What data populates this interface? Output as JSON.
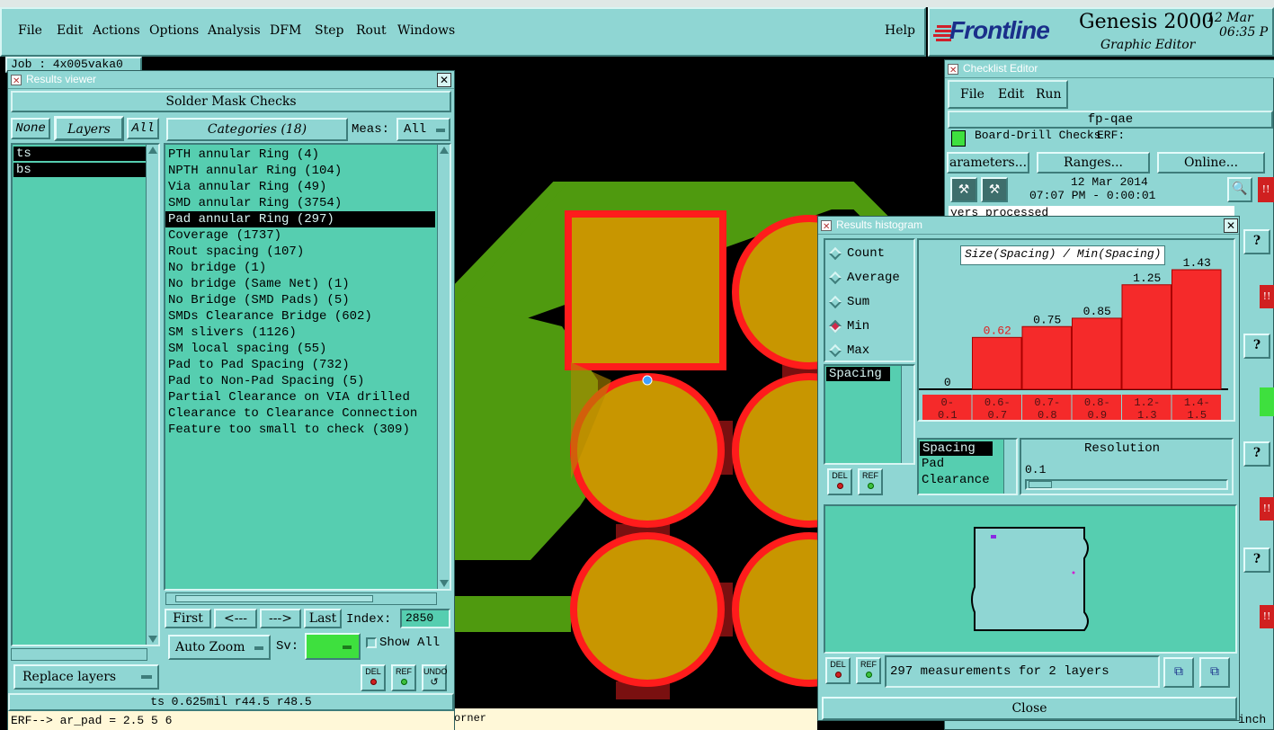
{
  "app_title": "Graphic Editor  Genesis 2000 - [fp-qae]",
  "menu": [
    "File",
    "Edit",
    "Actions",
    "Options",
    "Analysis",
    "DFM",
    "Step",
    "Rout",
    "Windows"
  ],
  "help": "Help",
  "brand": {
    "logo": "Frontline",
    "product": "Genesis 2000",
    "subtitle": "Graphic Editor",
    "date": "12 Mar",
    "time": "06:35 P"
  },
  "job_label": "Job : 4x005vaka0",
  "results_viewer": {
    "title": "Results viewer",
    "header": "Solder Mask Checks",
    "none": "None",
    "layers": "Layers",
    "all": "All",
    "layer_list": [
      "ts",
      "bs"
    ],
    "categories": "Categories (18)",
    "meas_label": "Meas:",
    "meas_value": "All",
    "category_list": [
      "PTH annular Ring (4)",
      "NPTH annular Ring (104)",
      "Via annular Ring (49)",
      "SMD annular Ring (3754)",
      "Pad annular Ring (297)",
      "Coverage (1737)",
      "Rout spacing (107)",
      "No bridge (1)",
      "No bridge (Same Net) (1)",
      "No Bridge (SMD Pads) (5)",
      "SMDs Clearance Bridge (602)",
      "SM slivers (1126)",
      "SM local spacing (55)",
      "Pad to Pad Spacing (732)",
      "Pad to Non-Pad Spacing (5)",
      "Partial Clearance on VIA drilled",
      "Clearance to Clearance Connection",
      "Feature too small to check (309)"
    ],
    "selected_category": 4,
    "first": "First",
    "prev": "<---",
    "next": "--->",
    "last": "Last",
    "index_label": "Index:",
    "index_value": "2850",
    "auto_zoom": "Auto Zoom",
    "sv": "Sv:",
    "show_all": "Show All",
    "replace_layers": "Replace layers",
    "del": "DEL",
    "ref": "REF",
    "undo": "UNDO",
    "status": "ts 0.625mil  r44.5  r48.5",
    "erf": "ERF--> ar_pad = 2.5 5 6"
  },
  "bottom_status": "orner",
  "checklist": {
    "title": "Checklist Editor",
    "menu": [
      "File",
      "Edit",
      "Run"
    ],
    "step": "fp-qae",
    "row_label": "Board-Drill Checks",
    "erf": "ERF:",
    "parameters": "arameters...",
    "ranges": "Ranges...",
    "online": "Online...",
    "date": "12 Mar 2014",
    "time": "07:07 PM - 0:00:01",
    "processed": "yers processed",
    "unit": "inch"
  },
  "histogram": {
    "title": "Results histogram",
    "modes": [
      "Count",
      "Average",
      "Sum",
      "Min",
      "Max"
    ],
    "selected_mode": "Min",
    "chart_title": "Size(Spacing) / Min(Spacing)",
    "measure_list": [
      "Spacing"
    ],
    "resolution_list": [
      "Spacing",
      "Pad",
      "Clearance"
    ],
    "resolution_label": "Resolution",
    "resolution_value": "0.1",
    "summary": "297 measurements for 2 layers",
    "close": "Close",
    "del": "DEL",
    "ref": "REF"
  },
  "chart_data": {
    "type": "bar",
    "title": "Size(Spacing) / Min(Spacing)",
    "categories": [
      "0-0.1",
      "0.6-0.7",
      "0.7-0.8",
      "0.8-0.9",
      "1.2-1.3",
      "1.4-1.5"
    ],
    "values": [
      0,
      0.62,
      0.75,
      0.85,
      1.25,
      1.43
    ],
    "value_labels": [
      "0",
      "0.62",
      "0.75",
      "0.85",
      "1.25",
      "1.43"
    ],
    "cat_top": [
      "0-",
      "0.6-",
      "0.7-",
      "0.8-",
      "1.2-",
      "1.4-"
    ],
    "cat_bottom": [
      "0.1",
      "0.7",
      "0.8",
      "0.9",
      "1.3",
      "1.5"
    ],
    "ylim": [
      0,
      1.6
    ]
  },
  "colors": {
    "panel": "#8fd6d3",
    "field": "#56ceb0",
    "bar": "#f52a2a",
    "board": "#000000",
    "trace": "#4f9a0f",
    "pad": "#c89600",
    "pad_outline": "#ff1c1c"
  }
}
